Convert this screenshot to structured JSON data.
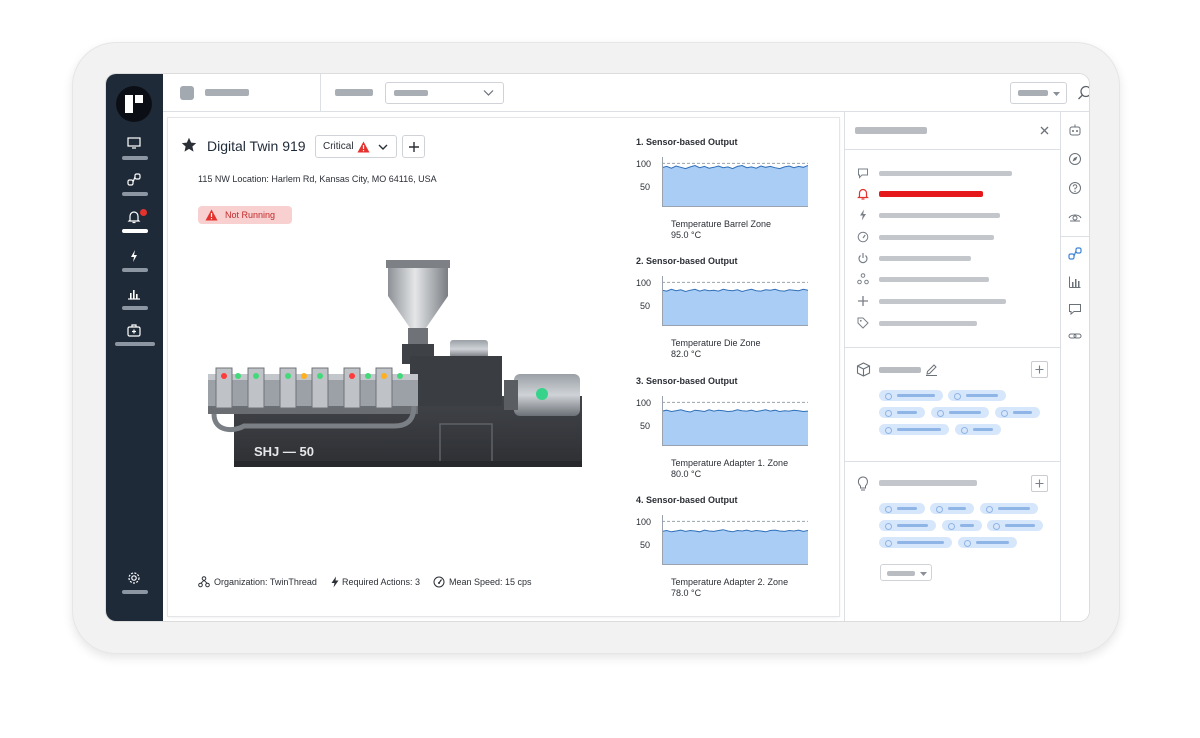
{
  "colors": {
    "nav_bg": "#1f2a38",
    "accent_blue": "#4a90e2",
    "chart_fill": "#a9cdf5",
    "alert_red": "#e5322d",
    "pill_bg": "#f8d0d0"
  },
  "nav": {
    "items": [
      {
        "icon": "monitor-icon"
      },
      {
        "icon": "workflow-icon"
      },
      {
        "icon": "bell-icon",
        "active": true,
        "has_notification": true
      },
      {
        "icon": "lightning-icon"
      },
      {
        "icon": "bar-chart-icon"
      },
      {
        "icon": "medkit-icon"
      }
    ],
    "settings_icon": "gear-icon"
  },
  "asset": {
    "title": "Digital Twin 919",
    "severity": "Critical",
    "address": "115 NW Location: Harlem Rd, Kansas City, MO 64116, USA",
    "status": "Not Running",
    "machine_label": "SHJ — 50",
    "footer": {
      "organization": "Organization: TwinThread",
      "actions": "Required Actions: 3",
      "speed": "Mean Speed: 15 cps"
    }
  },
  "charts": [
    {
      "heading": "1. Sensor-based Output",
      "tick_high": "100",
      "tick_mid": "50",
      "caption": "Temperature Barrel Zone",
      "value": "95.0 °C",
      "chart_data": {
        "type": "area",
        "ylim": [
          0,
          110
        ],
        "values": [
          90,
          93,
          89,
          94,
          91,
          88,
          92,
          95,
          90,
          93,
          89,
          91,
          94,
          90,
          92,
          88,
          93,
          95,
          90,
          92,
          89,
          94,
          91,
          93,
          90,
          88,
          92,
          94,
          90,
          93,
          91,
          95
        ]
      }
    },
    {
      "heading": "2. Sensor-based Output",
      "tick_high": "100",
      "tick_mid": "50",
      "caption": "Temperature Die Zone",
      "value": "82.0 °C",
      "chart_data": {
        "type": "area",
        "ylim": [
          0,
          110
        ],
        "values": [
          82,
          80,
          84,
          81,
          83,
          79,
          82,
          84,
          80,
          83,
          81,
          82,
          80,
          84,
          82,
          81,
          83,
          79,
          82,
          84,
          81,
          80,
          83,
          82,
          84,
          81,
          80,
          83,
          82,
          81,
          84,
          82
        ]
      }
    },
    {
      "heading": "3. Sensor-based Output",
      "tick_high": "100",
      "tick_mid": "50",
      "caption": "Temperature Adapter 1. Zone",
      "value": "80.0 °C",
      "chart_data": {
        "type": "area",
        "ylim": [
          0,
          110
        ],
        "values": [
          80,
          82,
          79,
          81,
          83,
          80,
          78,
          82,
          81,
          79,
          83,
          80,
          82,
          81,
          79,
          80,
          83,
          81,
          80,
          82,
          79,
          81,
          83,
          80,
          82,
          79,
          81,
          80,
          82,
          81,
          79,
          80
        ]
      }
    },
    {
      "heading": "4. Sensor-based Output",
      "tick_high": "100",
      "tick_mid": "50",
      "caption": "Temperature Adapter 2. Zone",
      "value": "78.0 °C",
      "chart_data": {
        "type": "area",
        "ylim": [
          0,
          110
        ],
        "values": [
          77,
          79,
          76,
          78,
          80,
          77,
          79,
          78,
          76,
          80,
          78,
          77,
          79,
          81,
          78,
          76,
          79,
          78,
          80,
          77,
          79,
          78,
          76,
          79,
          80,
          78,
          77,
          79,
          78,
          80,
          77,
          79
        ]
      }
    }
  ],
  "right_panel": {
    "close_icon": "close-icon",
    "list_icons": [
      "comment-icon",
      "alarm-bell-icon",
      "lightning-icon",
      "gauge-icon",
      "power-icon",
      "org-icon",
      "plus-icon",
      "tag-icon"
    ],
    "section2_icon": "cube-icon",
    "section3_icon": "lightbulb-icon"
  },
  "rail_icons": [
    "robot-icon",
    "compass-icon",
    "help-icon",
    "eye-settings-icon",
    "workflow-icon",
    "bar-chart-icon",
    "comment-icon",
    "link-icon"
  ]
}
